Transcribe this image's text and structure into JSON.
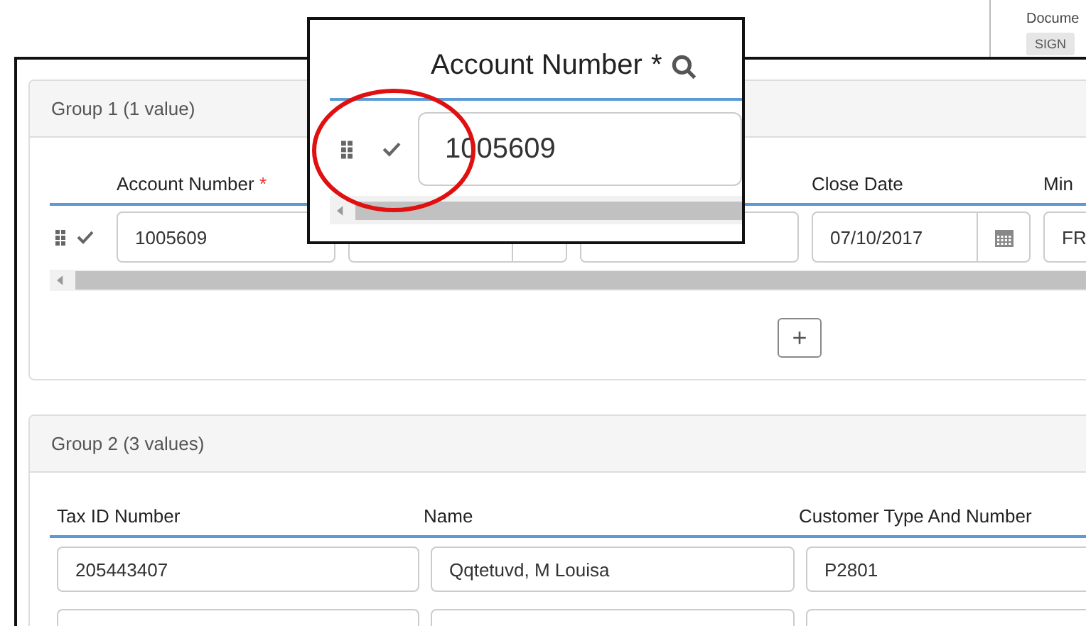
{
  "background_panel": {
    "label": "Docume",
    "button": "SIGN"
  },
  "group_1": {
    "title": "Group 1 (1 value)",
    "add_button": "+",
    "fields": [
      {
        "kind": "text",
        "label": "Account Number",
        "required_mark": "*",
        "value": "1005609"
      },
      {
        "kind": "lookup"
      },
      {
        "kind": "text"
      },
      {
        "kind": "date",
        "label": "Close Date",
        "value": "07/10/2017"
      },
      {
        "kind": "text",
        "label": "Min",
        "value": "FR"
      }
    ]
  },
  "group_2": {
    "title": "Group 2 (3 values)",
    "columns": [
      "Tax ID Number",
      "Name",
      "Customer Type And Number"
    ],
    "rows": [
      {
        "cells": [
          {
            "value": "205443407"
          },
          {
            "value": "Qqtetuvd, M Louisa"
          },
          {
            "value": "P2801"
          }
        ]
      },
      {
        "cells": [
          {},
          {},
          {}
        ]
      }
    ]
  },
  "zoom_inset": {
    "label": "Account Number",
    "required_mark": "*",
    "value": "1005609"
  }
}
